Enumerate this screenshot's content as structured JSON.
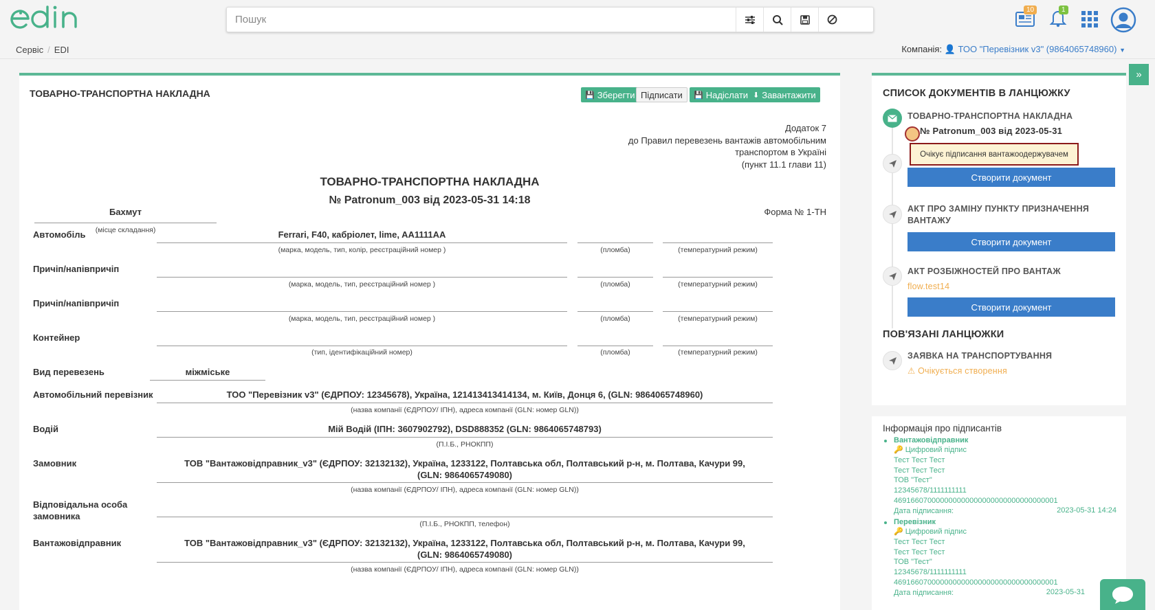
{
  "header": {
    "logo_text": "edin",
    "search_placeholder": "Пошук",
    "news_count": "10",
    "notif_count": "1"
  },
  "breadcrumb": [
    "Сервіс",
    "EDI"
  ],
  "company": {
    "label": "Компанія:",
    "name": "ТОО \"Перевізник v3\" (9864065748960)"
  },
  "doc": {
    "title": "ТОВАРНО-ТРАНСПОРТНА НАКЛАДНА",
    "buttons": {
      "save": "Зберегти",
      "sign": "Підписати",
      "send": "Надіслати",
      "download": "Завантажити"
    },
    "annex": [
      "Додаток 7",
      "до Правил перевезень вантажів автомобільним",
      "транспортом в Україні",
      "(пункт 11.1 глави 11)"
    ],
    "heading": "ТОВАРНО-ТРАНСПОРТНА НАКЛАДНА",
    "number": "№ Patronum_003 від 2023-05-31 14:18",
    "place": "Бахмут",
    "place_caption": "(місце складання)",
    "form": "Форма № 1-ТН",
    "rows": [
      {
        "label": "Автомобіль",
        "value": "Ferrari, F40, кабріолет, lime, AA1111AA",
        "caption": "(марка, модель, тип, колір, реєстраційний номер )",
        "seal": "(пломба)",
        "temp": "(температурний режим)"
      },
      {
        "label": "Причіп/напівпричіп",
        "value": "",
        "caption": "(марка, модель, тип, реєстраційний номер )",
        "seal": "(пломба)",
        "temp": "(температурний режим)"
      },
      {
        "label": "Причіп/напівпричіп",
        "value": "",
        "caption": "(марка, модель, тип, реєстраційний номер )",
        "seal": "(пломба)",
        "temp": "(температурний режим)"
      },
      {
        "label": "Контейнер",
        "value": "",
        "caption": "(тип, ідентифікаційний номер)",
        "seal": "(пломба)",
        "temp": "(температурний режим)"
      }
    ],
    "transport_type": {
      "label": "Вид перевезень",
      "value": "міжміське"
    },
    "parties": [
      {
        "label": "Автомобільний перевізник",
        "value": "ТОО \"Перевізник v3\" (ЄДРПОУ: 12345678), Україна, 121413413414134, м. Київ, Донця 6, (GLN: 9864065748960)",
        "caption": "(назва компанії (ЄДРПОУ/ ІПН), адреса компанії (GLN: номер GLN))"
      },
      {
        "label": "Водій",
        "value": "Мій Водій (ІПН: 3607902792), DSD888352 (GLN: 9864065748793)",
        "caption": "(П.І.Б., РНОКПП)"
      },
      {
        "label": "Замовник",
        "value": "ТОВ \"Вантажовідправник_v3\" (ЄДРПОУ: 32132132), Україна, 1233122, Полтавська обл, Полтавський р-н, м. Полтава, Качури 99, (GLN: 9864065749080)",
        "caption": "(назва компанії (ЄДРПОУ/ ІПН), адреса компанії (GLN: номер GLN))"
      },
      {
        "label": "Відповідальна особа замовника",
        "value": "",
        "caption": "(П.І.Б., РНОКПП, телефон)"
      },
      {
        "label": "Вантажовідправник",
        "value": "ТОВ \"Вантажовідправник_v3\" (ЄДРПОУ: 32132132), Україна, 1233122, Полтавська обл, Полтавський р-н, м. Полтава, Качури 99, (GLN: 9864065749080)",
        "caption": "(назва компанії (ЄДРПОУ/ ІПН), адреса компанії (GLN: номер GLN))"
      }
    ]
  },
  "chain": {
    "title": "СПИСОК ДОКУМЕНТІВ В ЛАНЦЮЖКУ",
    "current": {
      "title": "ТОВАРНО-ТРАНСПОРТНА НАКЛАДНА",
      "number": "№ Patronum_003 від 2023-05-31"
    },
    "tooltip": "Очікує підписання вантажоодержувачем",
    "create_label": "Створити документ",
    "doc2_title": "АКТ ПРО ЗАМІНУ ПУНКТУ ПРИЗНАЧЕННЯ ВАНТАЖУ",
    "doc3_title": "АКТ РОЗБІЖНОСТЕЙ ПРО ВАНТАЖ",
    "doc3_sub": "flow.test14",
    "related_title": "ПОВ'ЯЗАНІ ЛАНЦЮЖКИ",
    "related": {
      "title": "ЗАЯВКА НА ТРАНСПОРТУВАННЯ",
      "status": "Очікується створення"
    }
  },
  "signers": {
    "title": "Інформація про підписантів",
    "list": [
      {
        "role": "Вантажовідправник",
        "sig": "Цифровий підпис",
        "l1": "Тест Тест Тест",
        "l2": "Тест Тест Тест",
        "l3": "ТОВ \"Тест\"",
        "l4": "12345678/1111111111",
        "l5": "469166070000000000000000000000000000001",
        "date_label": "Дата підписання:",
        "date": "2023-05-31 14:24"
      },
      {
        "role": "Перевізник",
        "sig": "Цифровий підпис",
        "l1": "Тест Тест Тест",
        "l2": "Тест Тест Тест",
        "l3": "ТОВ \"Тест\"",
        "l4": "12345678/1111111111",
        "l5": "469166070000000000000000000000000000001",
        "date_label": "Дата підписання:",
        "date": "2023-05-31"
      }
    ]
  },
  "colors": {
    "accent_green": "#48b28a",
    "primary_blue": "#3a7dc9",
    "warning_orange": "#f0ad4e"
  }
}
